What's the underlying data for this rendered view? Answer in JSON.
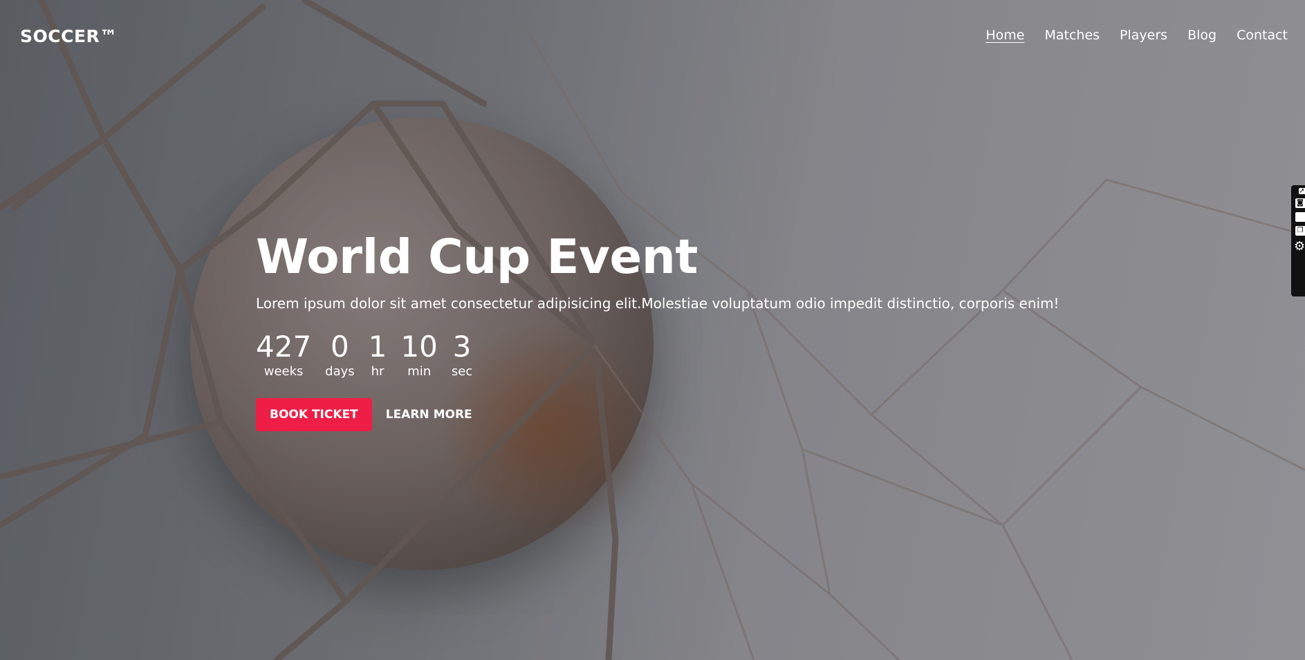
{
  "brand": {
    "logo_text": "SOCCER™"
  },
  "nav": {
    "links": [
      {
        "label": "Home",
        "active": true
      },
      {
        "label": "Matches",
        "active": false
      },
      {
        "label": "Players",
        "active": false
      },
      {
        "label": "Blog",
        "active": false
      },
      {
        "label": "Contact",
        "active": false
      }
    ]
  },
  "hero": {
    "title": "World Cup Event",
    "subtitle": "Lorem ipsum dolor sit amet consectetur adipisicing elit.Molestiae voluptatum odio impedit distinctio, corporis enim!",
    "countdown": [
      {
        "value": "427",
        "label": "weeks"
      },
      {
        "value": "0",
        "label": "days"
      },
      {
        "value": "1",
        "label": "hr"
      },
      {
        "value": "10",
        "label": "min"
      },
      {
        "value": "3",
        "label": "sec"
      }
    ],
    "primary_button": "BOOK TICKET",
    "secondary_button": "LEARN MORE",
    "background_image": "soccer ball in goal net"
  },
  "side_toolbar": {
    "icons": [
      "rocket-icon",
      "camera-icon",
      "square-icon",
      "copy-icon",
      "gear-icon"
    ]
  },
  "colors": {
    "accent": "#ee1e46",
    "text": "#ffffff"
  }
}
